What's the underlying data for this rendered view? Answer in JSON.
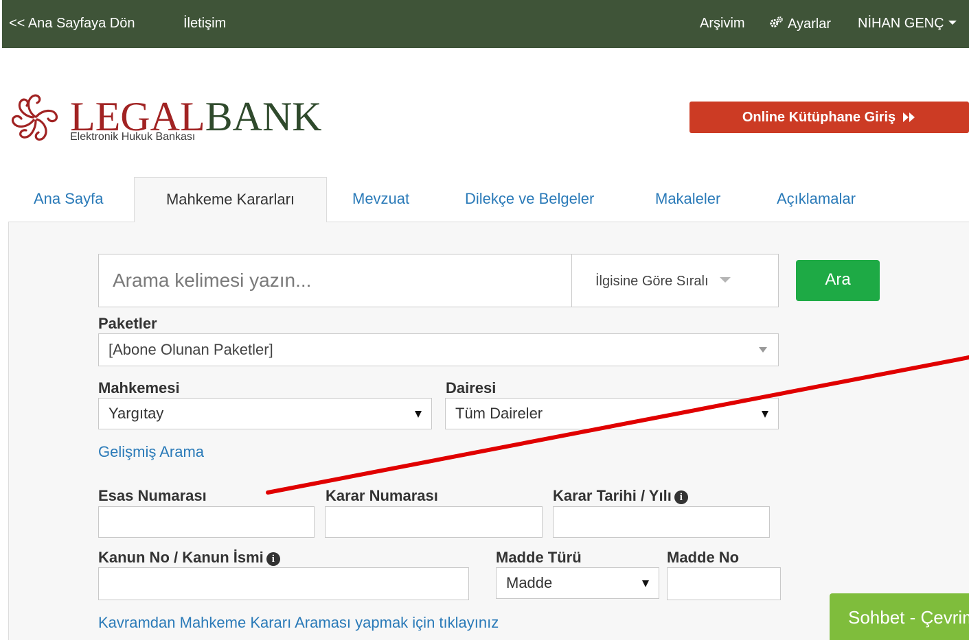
{
  "topbar": {
    "back_link": "<< Ana Sayfaya Dön",
    "contact_link": "İletişim",
    "archive_link": "Arşivim",
    "settings_link": "Ayarlar",
    "user_name": "NİHAN GENÇ",
    "background_color": "#3f5438"
  },
  "logo": {
    "word_legal": "LEGAL",
    "word_bank": "BANK",
    "tagline": "Elektronik Hukuk Bankası",
    "legal_color": "#a12323",
    "bank_color": "#2f4a2c"
  },
  "online_button": {
    "label": "Online Kütüphane Giriş",
    "color": "#cc3b24"
  },
  "tabs": [
    {
      "label": "Ana Sayfa",
      "active": false
    },
    {
      "label": "Mahkeme Kararları",
      "active": true
    },
    {
      "label": "Mevzuat",
      "active": false
    },
    {
      "label": "Dilekçe ve Belgeler",
      "active": false
    },
    {
      "label": "Makaleler",
      "active": false
    },
    {
      "label": "Açıklamalar",
      "active": false
    }
  ],
  "search": {
    "placeholder": "Arama kelimesi yazın...",
    "value": "",
    "sort_label": "İlgisine Göre Sıralı",
    "submit_label": "Ara",
    "submit_color": "#1eaa45"
  },
  "packages": {
    "label": "Paketler",
    "selected": "[Abone Olunan Paketler]"
  },
  "court": {
    "label": "Mahkemesi",
    "selected": "Yargıtay"
  },
  "chamber": {
    "label": "Dairesi",
    "selected": "Tüm Daireler"
  },
  "advanced_link": "Gelişmiş Arama",
  "case_number": {
    "label": "Esas Numarası",
    "value": ""
  },
  "decision_number": {
    "label": "Karar Numarası",
    "value": ""
  },
  "decision_date": {
    "label": "Karar Tarihi / Yılı",
    "value": ""
  },
  "law": {
    "label": "Kanun No / Kanun İsmi",
    "value": ""
  },
  "article_type": {
    "label": "Madde Türü",
    "selected": "Madde"
  },
  "article_no": {
    "label": "Madde No",
    "value": ""
  },
  "concept_link": "Kavramdan Mahkeme Kararı Araması yapmak için tıklayınız",
  "chat_button": {
    "label": "Sohbet - Çevrimiçi",
    "color": "#7fbd3c"
  },
  "annotation": {
    "color": "#e00000"
  }
}
